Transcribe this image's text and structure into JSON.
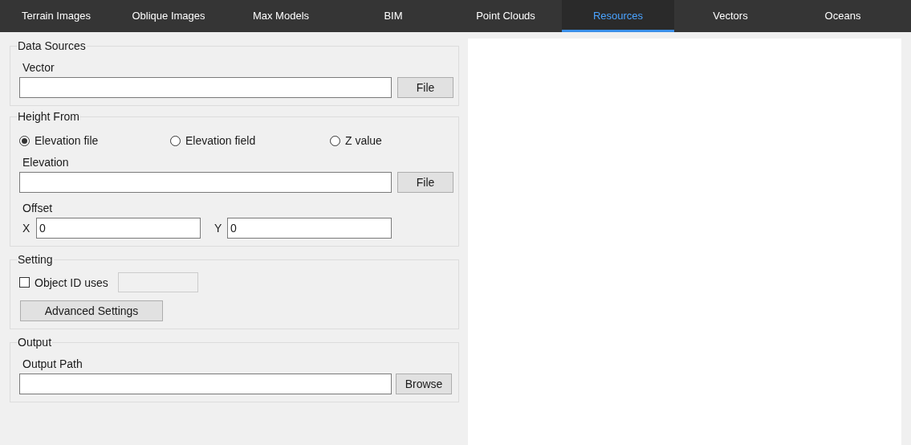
{
  "tabs": [
    {
      "label": "Terrain Images",
      "selected": false
    },
    {
      "label": "Oblique Images",
      "selected": false
    },
    {
      "label": "Max Models",
      "selected": false
    },
    {
      "label": "BIM",
      "selected": false
    },
    {
      "label": "Point Clouds",
      "selected": false
    },
    {
      "label": "Resources",
      "selected": true
    },
    {
      "label": "Vectors",
      "selected": false
    },
    {
      "label": "Oceans",
      "selected": false
    }
  ],
  "sections": [
    {
      "title": "Data Sources",
      "rows": [
        {
          "kind": "label",
          "text": "Vector"
        },
        {
          "kind": "file",
          "button": "File"
        }
      ]
    },
    {
      "title": "Height From",
      "rows": [
        {
          "kind": "radios",
          "options": [
            {
              "label": "Elevation file",
              "selected": true
            },
            {
              "label": "Elevation field",
              "selected": false
            },
            {
              "label": "Z value",
              "selected": false
            }
          ]
        },
        {
          "kind": "label",
          "text": "Elevation"
        },
        {
          "kind": "file",
          "button": "File"
        },
        {
          "kind": "label",
          "text": "Offset"
        },
        {
          "kind": "xy",
          "fields": [
            {
              "label": "X",
              "value": "0"
            },
            {
              "label": "Y",
              "value": "0"
            }
          ]
        }
      ]
    },
    {
      "title": "Setting",
      "rows": [
        {
          "kind": "checkbox",
          "label": "Object ID uses",
          "checked": false
        },
        {
          "kind": "button",
          "label": "Advanced Settings"
        }
      ]
    },
    {
      "title": "Output",
      "rows": [
        {
          "kind": "label",
          "text": "Output Path"
        },
        {
          "kind": "file",
          "button": "Browse"
        }
      ]
    }
  ]
}
